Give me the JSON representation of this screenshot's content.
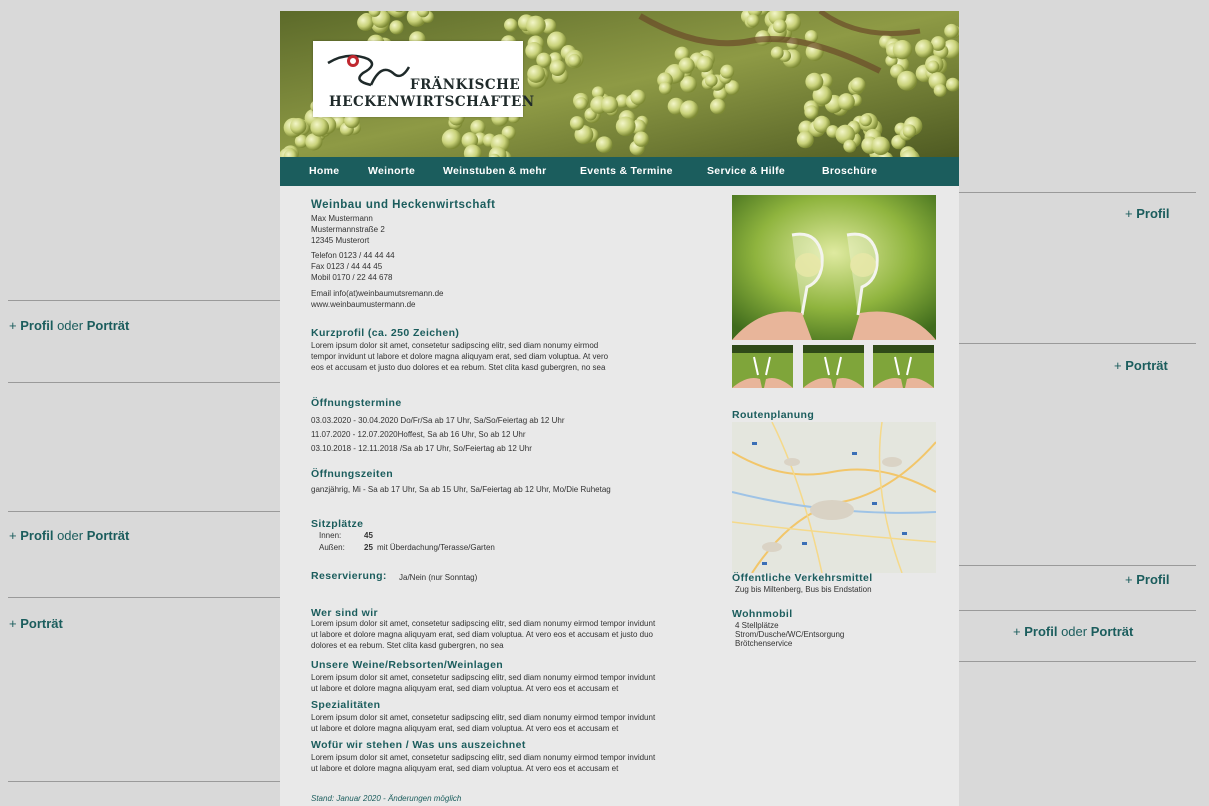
{
  "logo": {
    "line1": "FRÄNKISCHE",
    "line2": "HECKENWIRTSCHAFTEN"
  },
  "nav": [
    "Home",
    "Weinorte",
    "Weinstuben & mehr",
    "Events & Termine",
    "Service & Hilfe",
    "Broschüre"
  ],
  "contact": {
    "title": "Weinbau und Heckenwirtschaft",
    "name": "Max Mustermann",
    "street": "Mustermannstraße 2",
    "city": "12345 Musterort",
    "phone": "Telefon 0123 / 44 44 44",
    "fax": "Fax 0123 / 44 44 45",
    "mobile": "Mobil 0170 / 22 44 678",
    "email": "Email info(at)weinbaumutsremann.de",
    "web": "www.weinbaumustermann.de"
  },
  "kurzprofil": {
    "title": "Kurzprofil (ca. 250 Zeichen)",
    "lines": [
      "Lorem ipsum dolor sit amet, consetetur sadipscing elitr, sed diam nonumy eirmod",
      "tempor invidunt ut labore et dolore magna aliquyam erat, sed diam voluptua. At vero",
      "eos et accusam et justo duo dolores et ea rebum. Stet clita kasd gubergren, no sea"
    ]
  },
  "oeffnungstermine": {
    "title": "Öffnungstermine",
    "lines": [
      "03.03.2020 - 30.04.2020 Do/Fr/Sa ab 17 Uhr, Sa/So/Feiertag ab 12 Uhr",
      "11.07.2020 - 12.07.2020Hoffest, Sa ab 16 Uhr, So ab 12 Uhr",
      "03.10.2018 - 12.11.2018 /Sa ab 17 Uhr, So/Feiertag ab 12 Uhr"
    ]
  },
  "oeffnungszeiten": {
    "title": "Öffnungszeiten",
    "text": "ganzjährig, Mi - Sa ab 17 Uhr, Sa ab 15 Uhr, Sa/Feiertag ab 12 Uhr, Mo/Die Ruhetag"
  },
  "sitzplaetze": {
    "title": "Sitzplätze",
    "innen_label": "Innen:",
    "innen_value": "45",
    "aussen_label": "Außen:",
    "aussen_value": "25",
    "aussen_text": "mit Überdachung/Terasse/Garten"
  },
  "reservierung": {
    "title": "Reservierung:",
    "text": "Ja/Nein (nur Sonntag)"
  },
  "wer": {
    "title": "Wer sind wir",
    "lines": [
      "Lorem ipsum dolor sit amet, consetetur sadipscing elitr, sed diam nonumy eirmod tempor invidunt",
      "ut labore et dolore magna aliquyam erat, sed diam voluptua. At vero eos et accusam et justo duo",
      "dolores et ea rebum. Stet clita kasd gubergren, no sea"
    ]
  },
  "weine": {
    "title": "Unsere Weine/Rebsorten/Weinlagen",
    "lines": [
      "Lorem ipsum dolor sit amet, consetetur sadipscing elitr, sed diam nonumy eirmod tempor invidunt",
      "ut labore et dolore magna aliquyam erat, sed diam voluptua. At vero eos et accusam et"
    ]
  },
  "spezial": {
    "title": "Spezialitäten",
    "lines": [
      "Lorem ipsum dolor sit amet, consetetur sadipscing elitr, sed diam nonumy eirmod tempor invidunt",
      "ut labore et dolore magna aliquyam erat, sed diam voluptua. At vero eos et accusam et"
    ]
  },
  "wofuer": {
    "title": "Wofür wir stehen / Was uns auszeichnet",
    "lines": [
      "Lorem ipsum dolor sit amet, consetetur sadipscing elitr, sed diam nonumy eirmod tempor invidunt",
      "ut labore et dolore magna aliquyam erat, sed diam voluptua. At vero eos et accusam et"
    ]
  },
  "stand": "Stand: Januar 2020 - Änderungen möglich",
  "route": {
    "title": "Routenplanung"
  },
  "oepnv": {
    "title": "Öffentliche Verkehrsmittel",
    "text": "Zug bis Miltenberg, Bus bis Endstation"
  },
  "wohnmobil": {
    "title": "Wohnmobil",
    "lines": [
      "4 Stellplätze",
      "Strom/Dusche/WC/Entsorgung",
      "Brötchenservice"
    ]
  },
  "annotations": {
    "plus": "+",
    "profil": "Profil",
    "oder": "oder",
    "portraet": "Porträt"
  },
  "colors": {
    "teal": "#1b5d5d",
    "background": "#d9d9d9",
    "page": "#e9e9e9"
  }
}
